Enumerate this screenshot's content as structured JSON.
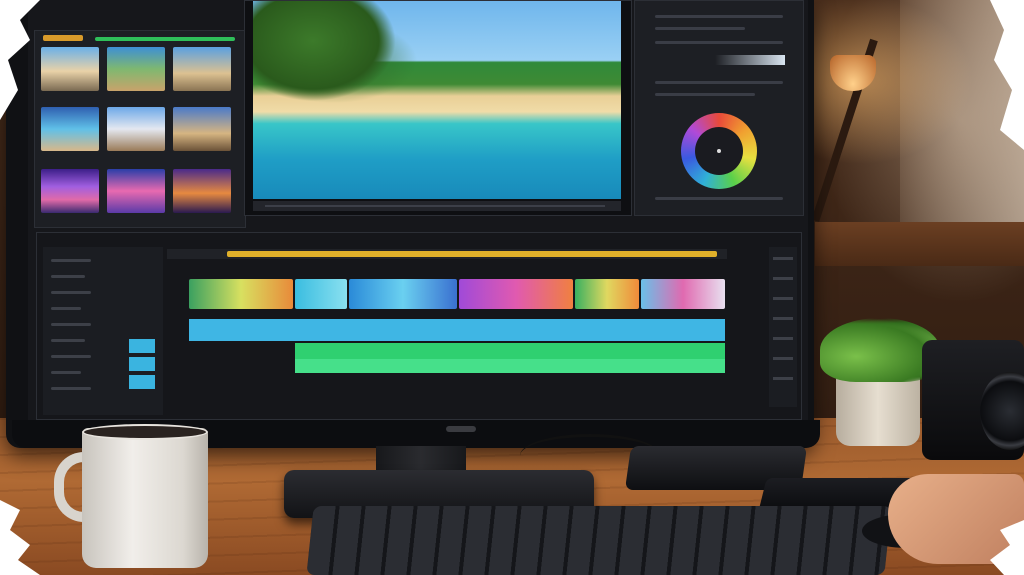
{
  "scene": {
    "subject": "",
    "accent_colors": {
      "timeline_gold": "#e0b02a",
      "video_track_blue": "#3fb6e4",
      "audio_track_green": "#2fd070",
      "bin_green": "#2fbf5a",
      "lamp_glow": "#ffd08a"
    }
  },
  "editor": {
    "icons": [
      "color-wheel-icon",
      "play-icon"
    ]
  }
}
